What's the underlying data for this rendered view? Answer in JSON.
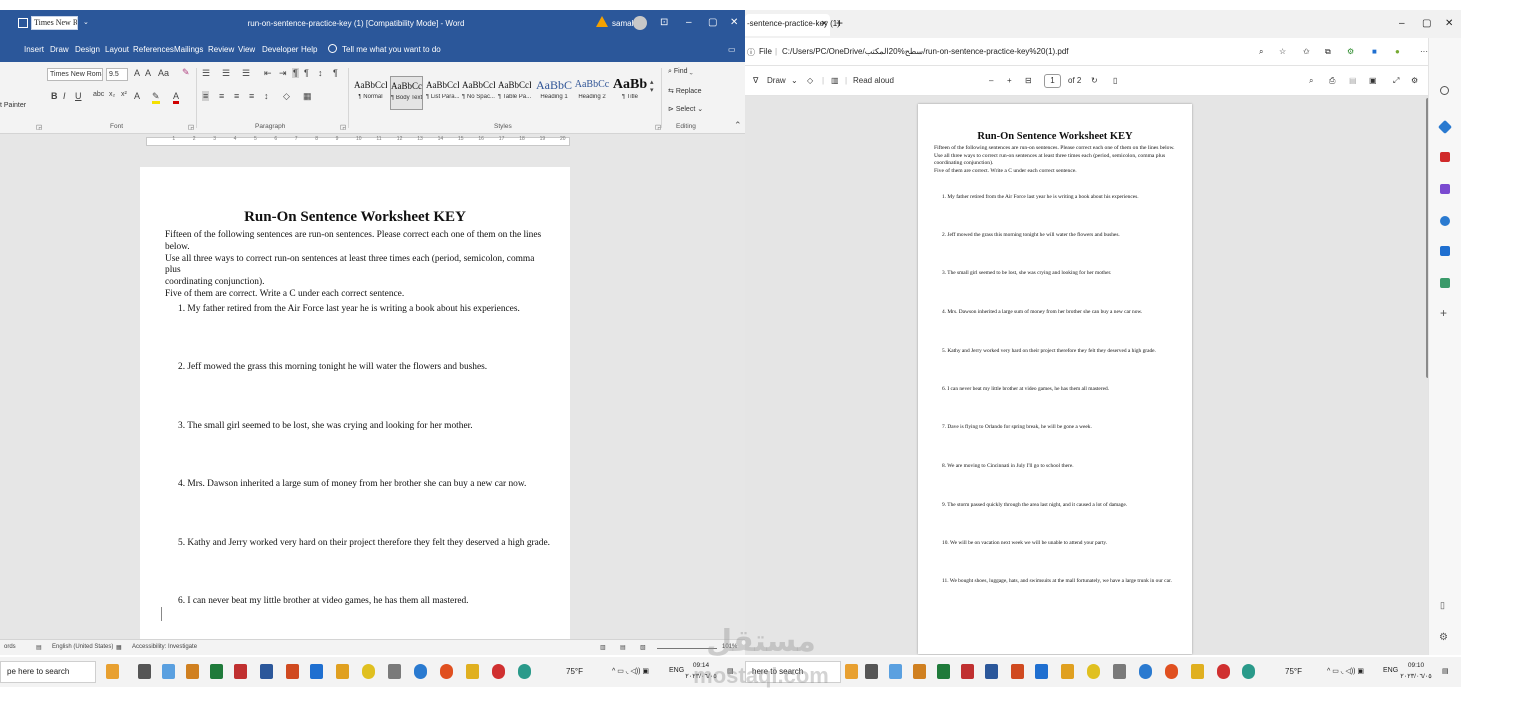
{
  "word": {
    "font_name_box": "Times New R",
    "doc_title": "run-on-sentence-practice-key (1) [Compatibility Mode] - Word",
    "user": "samah",
    "window_controls": [
      "⊡",
      "–",
      "▢",
      "✕"
    ],
    "tabs": [
      "Insert",
      "Draw",
      "Design",
      "Layout",
      "References",
      "Mailings",
      "Review",
      "View",
      "Developer",
      "Help"
    ],
    "tell_me": "Tell me what you want to do",
    "ribbon": {
      "format_painter": "t Painter",
      "font_face": "Times New Roman",
      "font_size": "9.5",
      "bold": "B",
      "italic": "I",
      "underline": "U",
      "styles": [
        {
          "preview": "AaBbCcD",
          "name": "¶ Normal",
          "color": "#111111"
        },
        {
          "preview": "AaBbCcI",
          "name": "¶ Body Text",
          "color": "#111111"
        },
        {
          "preview": "AaBbCcD",
          "name": "¶ List Para...",
          "color": "#111111"
        },
        {
          "preview": "AaBbCcD",
          "name": "¶ No Spac...",
          "color": "#111111"
        },
        {
          "preview": "AaBbCcD",
          "name": "¶ Table Pa...",
          "color": "#111111"
        },
        {
          "preview": "AaBbC",
          "name": "Heading 1",
          "color": "#2f5496"
        },
        {
          "preview": "AaBbCc",
          "name": "Heading 2",
          "color": "#2f5496"
        },
        {
          "preview": "AaBb",
          "name": "¶ Title",
          "color": "#111111"
        }
      ],
      "find": "Find",
      "replace": "Replace",
      "select": "Select",
      "groups": [
        "Font",
        "Paragraph",
        "Styles",
        "Editing"
      ]
    },
    "ruler_numbers": [
      "1",
      "2",
      "3",
      "4",
      "5",
      "6",
      "7",
      "8",
      "9",
      "10",
      "11",
      "12",
      "13",
      "14",
      "15",
      "16",
      "17",
      "18",
      "19",
      "20"
    ],
    "page": {
      "title": "Run-On Sentence Worksheet KEY",
      "intro_lines": [
        "Fifteen of the following sentences are run-on sentences.  Please correct each one of them on the lines below.",
        "Use all three ways to correct run-on sentences at least three times each (period, semicolon, comma plus",
        "coordinating conjunction).",
        "Five of them are correct.  Write a C under each correct sentence."
      ],
      "items": [
        "1.   My father retired from the Air Force last year he is writing a book about his experiences.",
        "2.   Jeff mowed the grass this morning tonight he will water the flowers and bushes.",
        "3.   The small girl seemed to be lost, she was crying and looking for her mother.",
        "4.   Mrs. Dawson inherited a large sum of money from her brother she can buy a new car now.",
        "5.   Kathy and Jerry worked very hard on their project therefore they felt they deserved a high grade.",
        "6.   I can never beat my little brother at video games, he has them all mastered."
      ]
    },
    "status": {
      "words": "ords",
      "language": "English (United States)",
      "accessibility": "Accessibility: Investigate",
      "zoom": "101%"
    }
  },
  "edge": {
    "tab_title": "-sentence-practice-key (1)",
    "new_tab": "+",
    "window_controls": [
      "–",
      "▢",
      "✕"
    ],
    "file_label": "File",
    "url": "C:/Users/PC/OneDrive/سطح%20المكتب/run-on-sentence-practice-key%20(1).pdf",
    "toolbar": {
      "draw": "Draw",
      "read_aloud": "Read aloud",
      "page_num": "1",
      "page_total": "of 2"
    },
    "page": {
      "title": "Run-On Sentence Worksheet KEY",
      "intro_lines": [
        "Fifteen of the following sentences are run-on sentences.  Please correct each one of them on the lines below.",
        "Use all three ways to correct run-on sentences at least three times each (period, semicolon, comma plus",
        "coordinating conjunction).",
        "Five of them are correct.  Write a C under each correct sentence."
      ],
      "items": [
        "1.   My father retired from the Air Force last year he is writing a book about his experiences.",
        "2.   Jeff mowed the grass this morning tonight he will water the flowers and bushes.",
        "3.   The small girl seemed to be lost, she was crying and looking for her mother.",
        "4.   Mrs. Dawson inherited a large sum of money from her brother she can buy a new car now.",
        "5.   Kathy and Jerry worked very hard on their project therefore they felt they deserved a high grade.",
        "6.   I can never beat my little brother at video games, he has them all mastered.",
        "7.   Dave is flying to Orlando for spring break, he will be gone a week.",
        "8.   We are moving to Cincinnati in July I'll go to school there.",
        "9.   The storm passed quickly through the area last night, and it caused a lot of damage.",
        "10. We will be on vacation next week we will be unable to attend your party.",
        "11. We bought shoes, luggage, hats, and swimsuits at the mall fortunately, we have a large trunk in our car."
      ]
    }
  },
  "taskbar": {
    "search_left": "pe here to search",
    "search_right": "here to search",
    "weather": "75°F",
    "lang": "ENG",
    "time_left": "09:14",
    "time_right": "09:10",
    "date": "٢٠٢٣/٠٦/٠٥"
  },
  "watermark": {
    "arabic": "مستقل",
    "latin": "mostaql.com"
  },
  "colors": {
    "word_blue": "#2b579a",
    "edge_accent": "#0078d4"
  }
}
